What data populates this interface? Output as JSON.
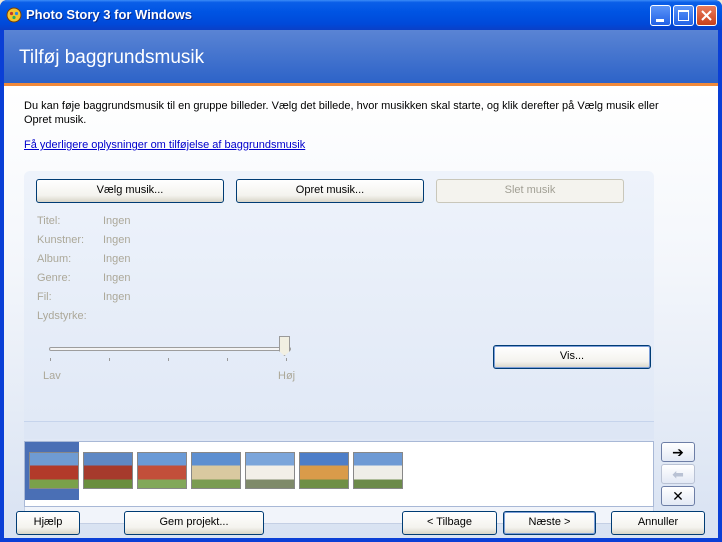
{
  "window": {
    "title": "Photo Story 3 for Windows"
  },
  "header": {
    "title": "Tilføj baggrundsmusik"
  },
  "intro": {
    "text": "Du kan føje baggrundsmusik til en gruppe billeder. Vælg det billede, hvor musikken skal starte, og klik derefter på Vælg musik eller Opret musik.",
    "help_link": "Få yderligere oplysninger om tilføjelse af baggrundsmusik"
  },
  "music_buttons": {
    "select": "Vælg musik...",
    "create": "Opret musik...",
    "delete": "Slet musik"
  },
  "metadata": {
    "title_label": "Titel:",
    "title_value": "Ingen",
    "artist_label": "Kunstner:",
    "artist_value": "Ingen",
    "album_label": "Album:",
    "album_value": "Ingen",
    "genre_label": "Genre:",
    "genre_value": "Ingen",
    "file_label": "Fil:",
    "file_value": "Ingen",
    "volume_label": "Lydstyrke:"
  },
  "volume": {
    "low_label": "Lav",
    "high_label": "Høj",
    "level": 1.0
  },
  "preview_button": "Vis...",
  "filmstrip": {
    "thumbnails": [
      "photo-1",
      "photo-2",
      "photo-3",
      "photo-4",
      "photo-5",
      "photo-6",
      "photo-7"
    ],
    "selected_index": 0
  },
  "side_buttons": {
    "right": "➔",
    "left": "⬅",
    "remove": "✕"
  },
  "footer": {
    "help": "Hjælp",
    "save": "Gem projekt...",
    "back": "< Tilbage",
    "next": "Næste >",
    "cancel": "Annuller"
  }
}
